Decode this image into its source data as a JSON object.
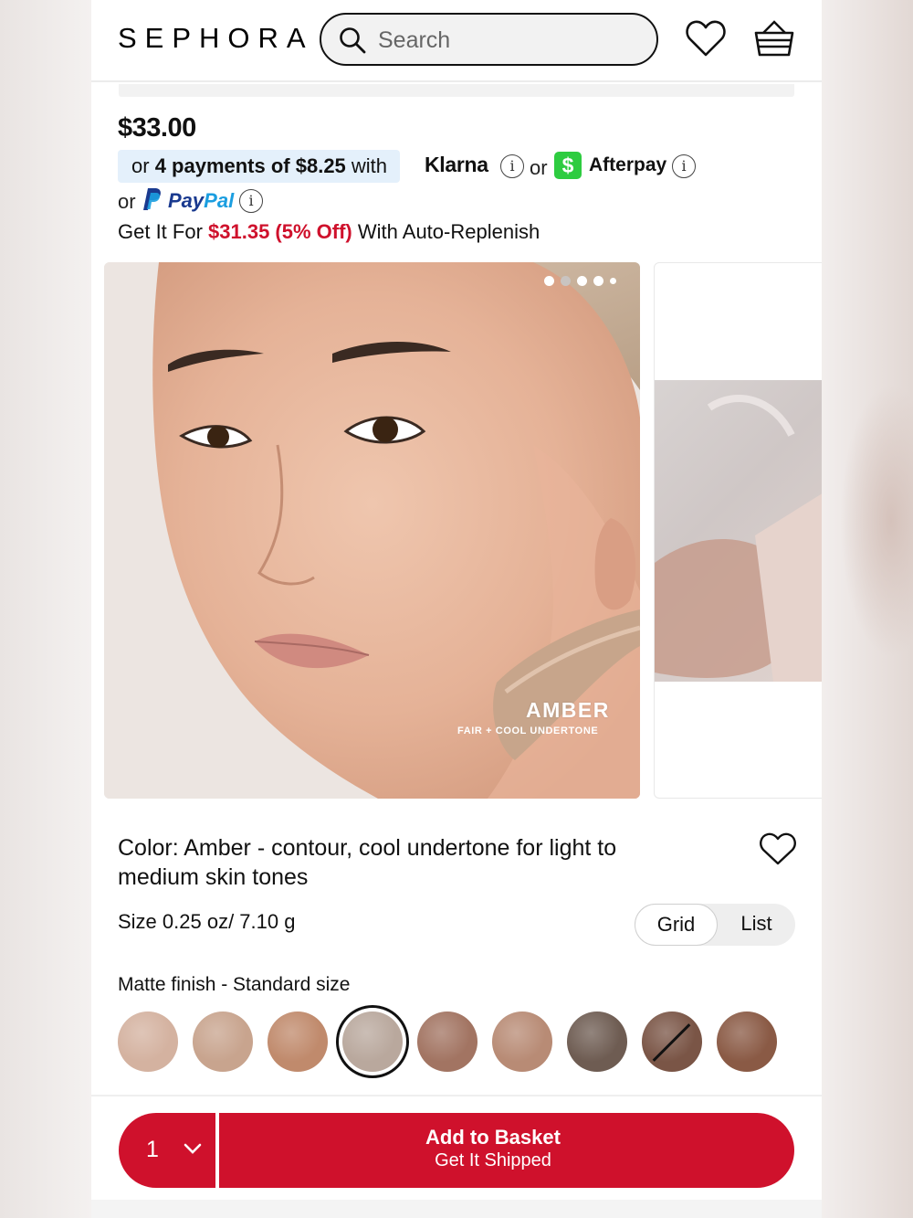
{
  "header": {
    "logo": "SEPHORA",
    "search_placeholder": "Search"
  },
  "pricing": {
    "price": "$33.00",
    "installments_prefix": "or ",
    "installments_bold": "4 payments of $8.25",
    "installments_suffix": " with",
    "klarna": "Klarna",
    "or1": "or",
    "afterpay_badge": "$",
    "afterpay": "Afterpay",
    "or2": "or",
    "paypal_pay": "Pay",
    "paypal_pal": "Pal",
    "info_symbol": "i",
    "replenish_prefix": "Get It For ",
    "replenish_price": "$31.35 (5% Off)",
    "replenish_suffix": " With Auto-Replenish"
  },
  "carousel": {
    "total_slides": 5,
    "active_slide": 2,
    "shade_name": "AMBER",
    "shade_desc": "FAIR + COOL UNDERTONE"
  },
  "details": {
    "color_line": "Color: Amber - contour, cool undertone for light to medium skin tones",
    "size_line": "Size 0.25 oz/ 7.10 g",
    "view_grid": "Grid",
    "view_list": "List",
    "finish_label": "Matte finish - Standard size"
  },
  "swatches": [
    {
      "color": "#d4b2a0",
      "selected": false,
      "unavailable": false
    },
    {
      "color": "#c8a48e",
      "selected": false,
      "unavailable": false
    },
    {
      "color": "#c08a6c",
      "selected": false,
      "unavailable": false
    },
    {
      "color": "#b9a89d",
      "selected": true,
      "unavailable": false
    },
    {
      "color": "#a27462",
      "selected": false,
      "unavailable": false
    },
    {
      "color": "#b88b75",
      "selected": false,
      "unavailable": false
    },
    {
      "color": "#6e5c52",
      "selected": false,
      "unavailable": false
    },
    {
      "color": "#7a5546",
      "selected": false,
      "unavailable": true
    },
    {
      "color": "#8a5a45",
      "selected": false,
      "unavailable": false
    }
  ],
  "bottom_bar": {
    "quantity": "1",
    "add_label": "Add to Basket",
    "add_sub": "Get It Shipped"
  },
  "colors": {
    "brand_red": "#cf112c",
    "klarna_bg": "#e4f0fb",
    "afterpay_green": "#2ecc40",
    "paypal_dark": "#1a3a8f",
    "paypal_light": "#1b9ee0"
  }
}
